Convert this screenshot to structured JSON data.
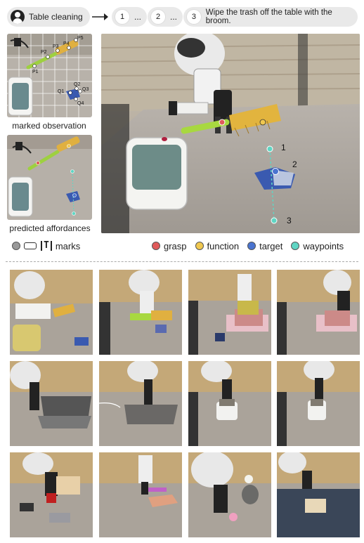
{
  "pipeline": {
    "task_label": "Table cleaning",
    "step1_num": "1",
    "step1_text": "...",
    "step2_num": "2",
    "step2_text": "...",
    "step3_num": "3",
    "step3_text": "Wipe the trash off the table with the broom."
  },
  "observation": {
    "points": [
      "P1",
      "P2",
      "P3",
      "P4",
      "P5",
      "Q1",
      "Q2",
      "Q3",
      "Q4"
    ],
    "caption": "marked observation"
  },
  "affordances": {
    "caption": "predicted affordances"
  },
  "main_view": {
    "waypoints": [
      "1",
      "2",
      "3"
    ]
  },
  "legend": {
    "marks_label": "marks",
    "marks_glyph": "T",
    "grasp": "grasp",
    "function": "function",
    "target": "target",
    "waypoints": "waypoints"
  },
  "colors": {
    "grasp": "#e05a5a",
    "function": "#f0c850",
    "target": "#4a74d0",
    "waypoints": "#5fd6c4",
    "marks": "#999999"
  }
}
